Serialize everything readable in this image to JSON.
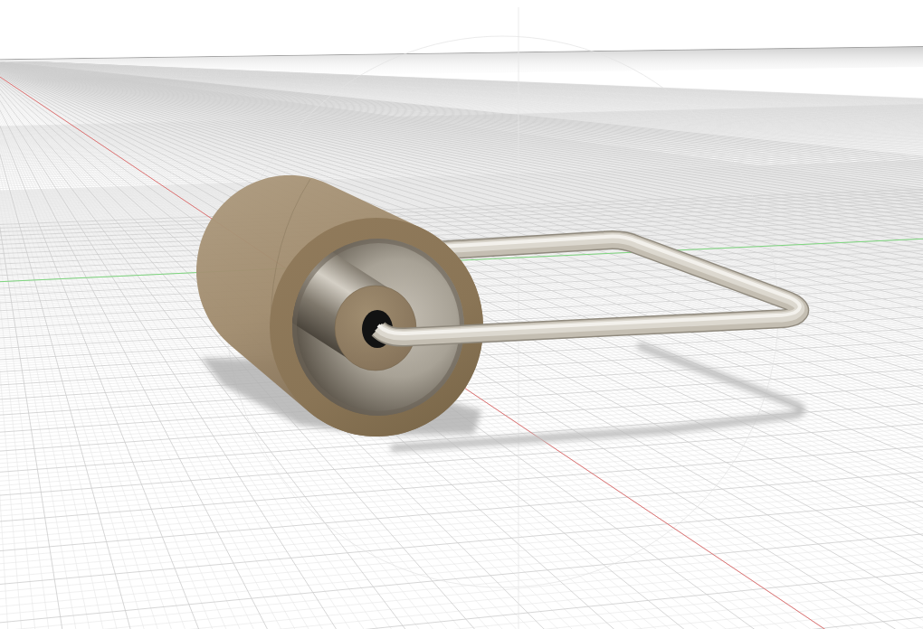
{
  "viewport": {
    "grid": true,
    "axes": true,
    "shadows": true
  }
}
